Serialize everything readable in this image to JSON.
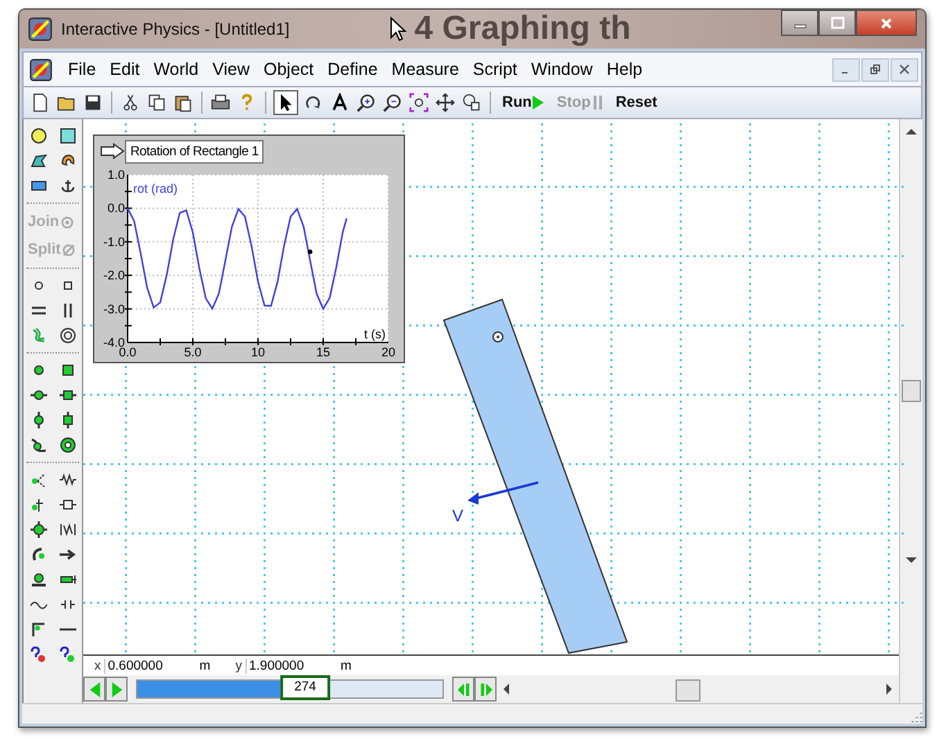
{
  "window": {
    "title": "Interactive Physics - [Untitled1]",
    "background_text": "4 Graphing th"
  },
  "menu": [
    {
      "label": "File"
    },
    {
      "label": "Edit"
    },
    {
      "label": "World"
    },
    {
      "label": "View"
    },
    {
      "label": "Object"
    },
    {
      "label": "Define"
    },
    {
      "label": "Measure"
    },
    {
      "label": "Script"
    },
    {
      "label": "Window"
    },
    {
      "label": "Help"
    }
  ],
  "toolbar": {
    "run": {
      "label": "Run",
      "disabled": false
    },
    "stop": {
      "label": "Stop",
      "disabled": true
    },
    "reset": {
      "label": "Reset",
      "disabled": false
    }
  },
  "palette": {
    "join": {
      "label": "Join",
      "disabled": true
    },
    "split": {
      "label": "Split",
      "disabled": true
    }
  },
  "graph": {
    "title": "Rotation of Rectangle 1",
    "chart_data": {
      "type": "line",
      "xlabel": "t (s)",
      "x": [
        0,
        0.5,
        1,
        1.5,
        2,
        2.5,
        3,
        3.5,
        4,
        4.5,
        5,
        5.5,
        6,
        6.5,
        7,
        7.5,
        8,
        8.5,
        9,
        9.5,
        10,
        10.5,
        11,
        11.5,
        12,
        12.5,
        13,
        13.5,
        14,
        14.5,
        15,
        15.5,
        16,
        16.5,
        16.8
      ],
      "series": [
        {
          "name": "rot (rad)",
          "color": "#4040e0",
          "values": [
            0,
            -0.38,
            -1.34,
            -2.37,
            -2.96,
            -2.81,
            -1.99,
            -0.92,
            -0.14,
            -0.06,
            -0.72,
            -1.79,
            -2.69,
            -2.99,
            -2.54,
            -1.55,
            -0.55,
            -0.02,
            -0.25,
            -1.12,
            -2.18,
            -2.9,
            -2.91,
            -2.19,
            -1.12,
            -0.25,
            -0.02,
            -0.55,
            -1.56,
            -2.55,
            -3.0,
            -2.67,
            -1.77,
            -0.71,
            -0.3
          ]
        }
      ],
      "xlim": [
        0,
        20
      ],
      "ylim": [
        -4,
        1
      ],
      "grid": true,
      "xticks": [
        {
          "value": 0,
          "label": "0.0"
        },
        {
          "value": 5,
          "label": "5.0"
        },
        {
          "value": 10,
          "label": "10"
        },
        {
          "value": 15,
          "label": "15"
        },
        {
          "value": 20,
          "label": "20"
        }
      ],
      "yticks": [
        {
          "value": 1,
          "label": "1.0"
        },
        {
          "value": 0,
          "label": "0.0"
        },
        {
          "value": -1,
          "label": "-1.0"
        },
        {
          "value": -2,
          "label": "-2.0"
        },
        {
          "value": -3,
          "label": "-3.0"
        },
        {
          "value": -4,
          "label": "-4.0"
        }
      ]
    }
  },
  "canvas": {
    "velocity_label": "V"
  },
  "coordinates": {
    "x_label": "x",
    "x_value": "0.600000",
    "x_unit": "m",
    "y_label": "y",
    "y_value": "1.900000",
    "y_unit": "m"
  },
  "playback": {
    "frame": "274",
    "level": 0.55
  }
}
